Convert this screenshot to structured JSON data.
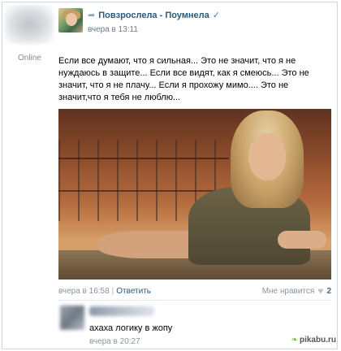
{
  "sidebar": {
    "status": "Online"
  },
  "post": {
    "author": "Повзрослела - Поумнела",
    "time": "вчера в 13:11",
    "text": "Если все думают, что я сильная... Это не значит, что я не нуждаюсь в защите... Если все видят, как я смеюсь... Это не значит, что я не плачу... Если я прохожу мимо.... Это не значит,что я тебя не люблю...",
    "footer": {
      "time": "вчера в 16:58",
      "separator": "|",
      "reply_label": "Ответить",
      "like_label": "Мне нравится",
      "like_count": "2"
    }
  },
  "comment": {
    "text": "ахаха логику в жопу",
    "time": "вчера в 20:27"
  },
  "watermark": {
    "text": "pikabu.ru"
  },
  "icons": {
    "share": "share-arrow-icon",
    "verified": "checkmark-icon",
    "heart": "heart-icon",
    "watermark": "pikabu-leaf-icon"
  },
  "colors": {
    "link": "#2b587a",
    "meta": "#8a95a0",
    "like_count": "#45688e"
  }
}
